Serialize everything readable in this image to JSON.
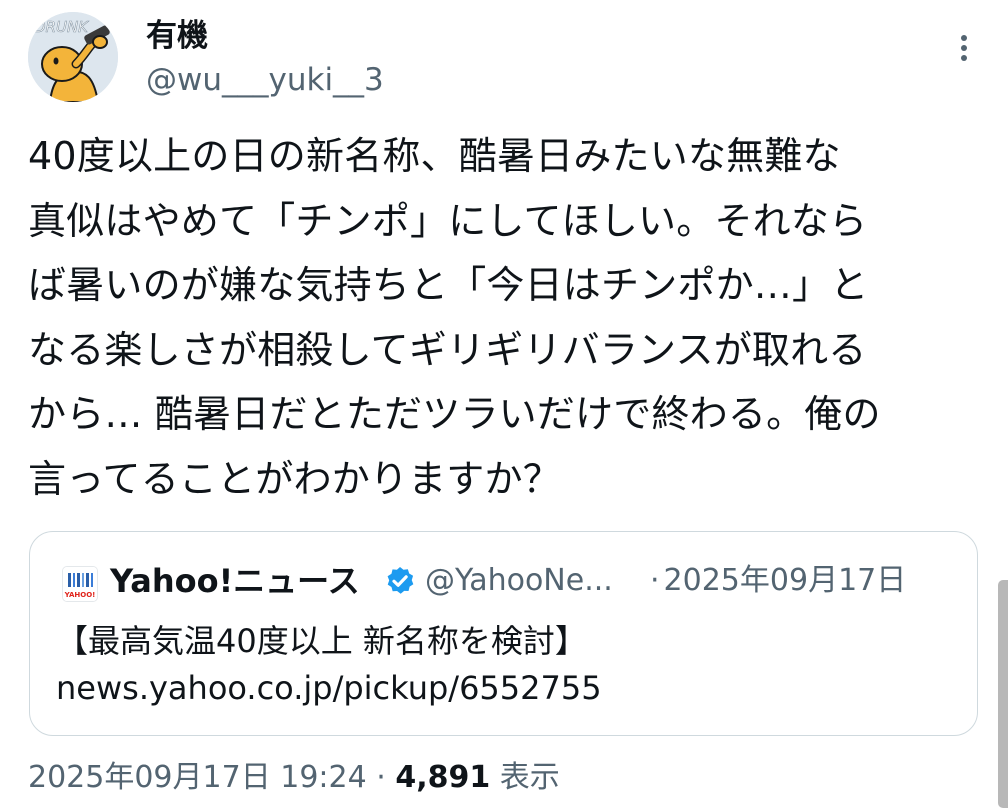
{
  "author": {
    "display_name": "有機",
    "handle": "@wu___yuki__3",
    "avatar_text": "DRUNK",
    "avatar_icon": "drinking-cartoon-character"
  },
  "tweet": {
    "lines": [
      "40度以上の日の新名称、酷暑日みたいな無難な",
      "真似はやめて「チンポ」にしてほしい。それなら",
      "ば暑いのが嫌な気持ちと「今日はチンポか…」と",
      "なる楽しさが相殺してギリギリバランスが取れる",
      "から… 酷暑日だとただツラいだけで終わる。俺の",
      "言ってることがわかりますか？"
    ]
  },
  "quote": {
    "name": "Yahoo!ニュース",
    "handle": "@YahooNe...",
    "date": "2025年09月17日",
    "separator": "·",
    "lines": [
      "【最高気温40度以上 新名称を検討】",
      "news.yahoo.co.jp/pickup/6552755"
    ],
    "icon": "yahoo-news-icon",
    "icon_text": "YAHOO!",
    "verified_icon": "verified-badge-icon"
  },
  "meta": {
    "timestamp": "2025年09月17日 19:24",
    "separator": "·",
    "views_count": "4,891",
    "views_label": "表示"
  },
  "colors": {
    "text": "#0f1419",
    "secondary": "#536471",
    "border": "#cfd9de",
    "verified": "#1d9bf0"
  }
}
